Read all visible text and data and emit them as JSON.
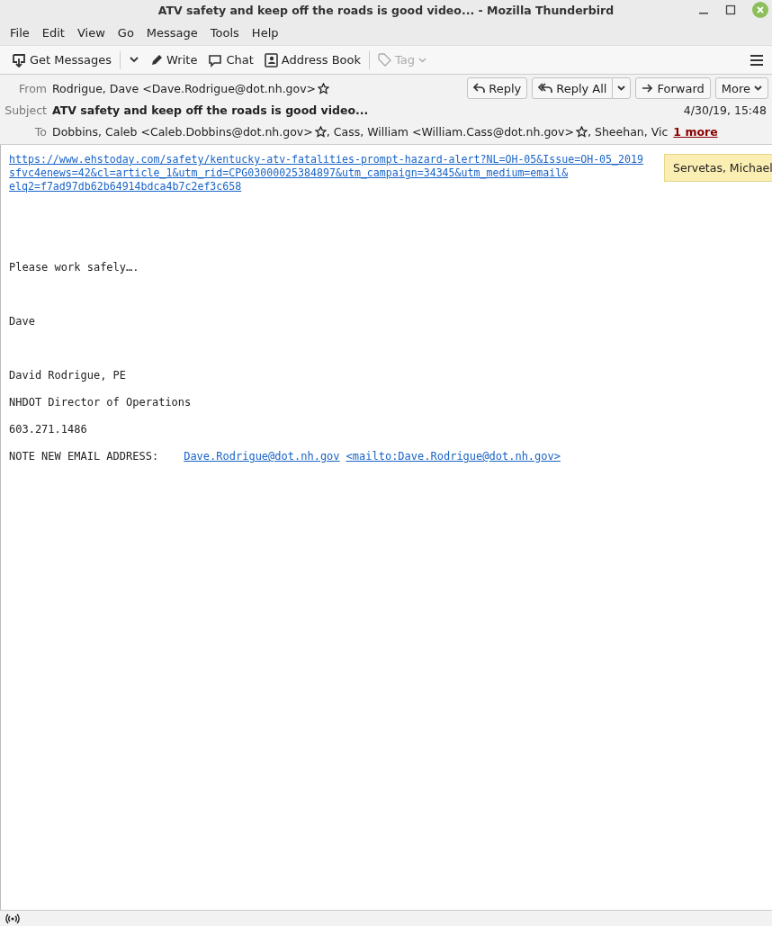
{
  "window": {
    "title": "ATV safety and keep off the roads is good video... - Mozilla Thunderbird"
  },
  "menu": [
    "File",
    "Edit",
    "View",
    "Go",
    "Message",
    "Tools",
    "Help"
  ],
  "toolbar": [
    {
      "kind": "get",
      "label": "Get Messages",
      "disabled": false
    },
    {
      "kind": "write",
      "label": "Write",
      "disabled": false
    },
    {
      "kind": "chat",
      "label": "Chat",
      "disabled": false
    },
    {
      "kind": "book",
      "label": "Address Book",
      "disabled": false
    },
    {
      "kind": "tag",
      "label": "Tag",
      "disabled": true
    }
  ],
  "header": {
    "from_label": "From",
    "from": "Rodrigue, Dave <Dave.Rodrigue@dot.nh.gov>",
    "subject_label": "Subject",
    "subject": "ATV safety and keep off the roads is good video...",
    "date": "4/30/19, 15:48",
    "to_label": "To",
    "to": [
      "Dobbins, Caleb <Caleb.Dobbins@dot.nh.gov>",
      "Cass, William <William.Cass@dot.nh.gov>"
    ],
    "to_separator": ",",
    "to_cut": "Sheehan, Vic",
    "more": "1 more",
    "actions": [
      {
        "kind": "reply",
        "label": "Reply"
      },
      {
        "kind": "replyall",
        "label": "Reply All"
      },
      {
        "kind": "forward",
        "label": "Forward"
      },
      {
        "kind": "more",
        "label": "More"
      }
    ]
  },
  "tooltip": "Servetas, Michael",
  "body": {
    "link": "https://www.ehstoday.com/safety/kentucky-atv-fatalities-prompt-hazard-alert?NL=OH-05&Issue=OH-05_2019\nsfvc4enews=42&cl=article_1&utm_rid=CPG03000025384897&utm_campaign=34345&utm_medium=email&\nelq2=f7ad97db62b64914bdca4b7c2ef3c658",
    "paragraphs": [
      "Please work safely….",
      "Dave",
      "David Rodrigue, PE",
      "NHDOT Director of Operations",
      "603.271.1486"
    ],
    "note_label": "NOTE NEW EMAIL ADDRESS:",
    "note_email": "Dave.Rodrigue@dot.nh.gov",
    "note_mailto": "<mailto:Dave.Rodrigue@dot.nh.gov>"
  }
}
